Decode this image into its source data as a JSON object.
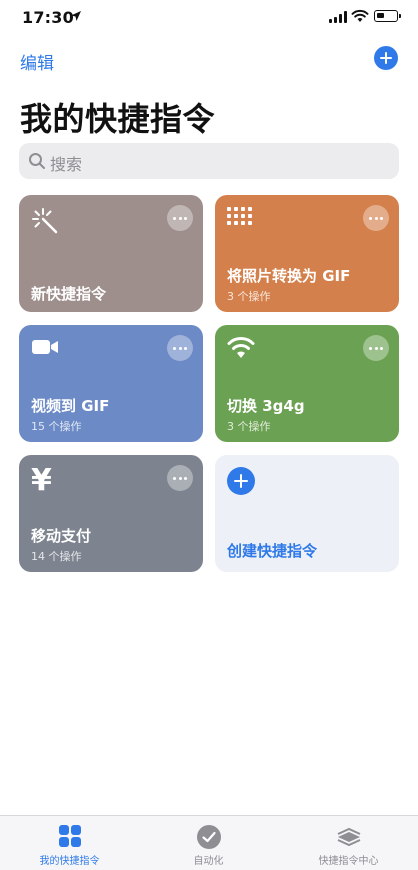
{
  "status": {
    "time": "17:30"
  },
  "nav": {
    "edit_label": "编辑"
  },
  "page": {
    "title": "我的快捷指令"
  },
  "search": {
    "placeholder": "搜索"
  },
  "shortcuts": [
    {
      "name": "新快捷指令",
      "actions": "",
      "color": "#9e8f8d",
      "icon": "magic-wand-icon"
    },
    {
      "name": "将照片转换为 GIF",
      "actions": "3 个操作",
      "color": "#d4804c",
      "icon": "grid-dots-icon"
    },
    {
      "name": "视频到 GIF",
      "actions": "15 个操作",
      "color": "#6c8ac6",
      "icon": "video-camera-icon"
    },
    {
      "name": "切换 3g4g",
      "actions": "3 个操作",
      "color": "#6ba152",
      "icon": "wifi-icon"
    },
    {
      "name": "移动支付",
      "actions": "14 个操作",
      "color": "#7d8490",
      "icon": "yen-icon",
      "icon_glyph": "¥"
    }
  ],
  "create": {
    "label": "创建快捷指令"
  },
  "tabs": [
    {
      "label": "我的快捷指令",
      "icon": "grid-icon",
      "active": true
    },
    {
      "label": "自动化",
      "icon": "automation-icon",
      "active": false
    },
    {
      "label": "快捷指令中心",
      "icon": "gallery-icon",
      "active": false
    }
  ],
  "colors": {
    "accent": "#2f7ae8"
  }
}
